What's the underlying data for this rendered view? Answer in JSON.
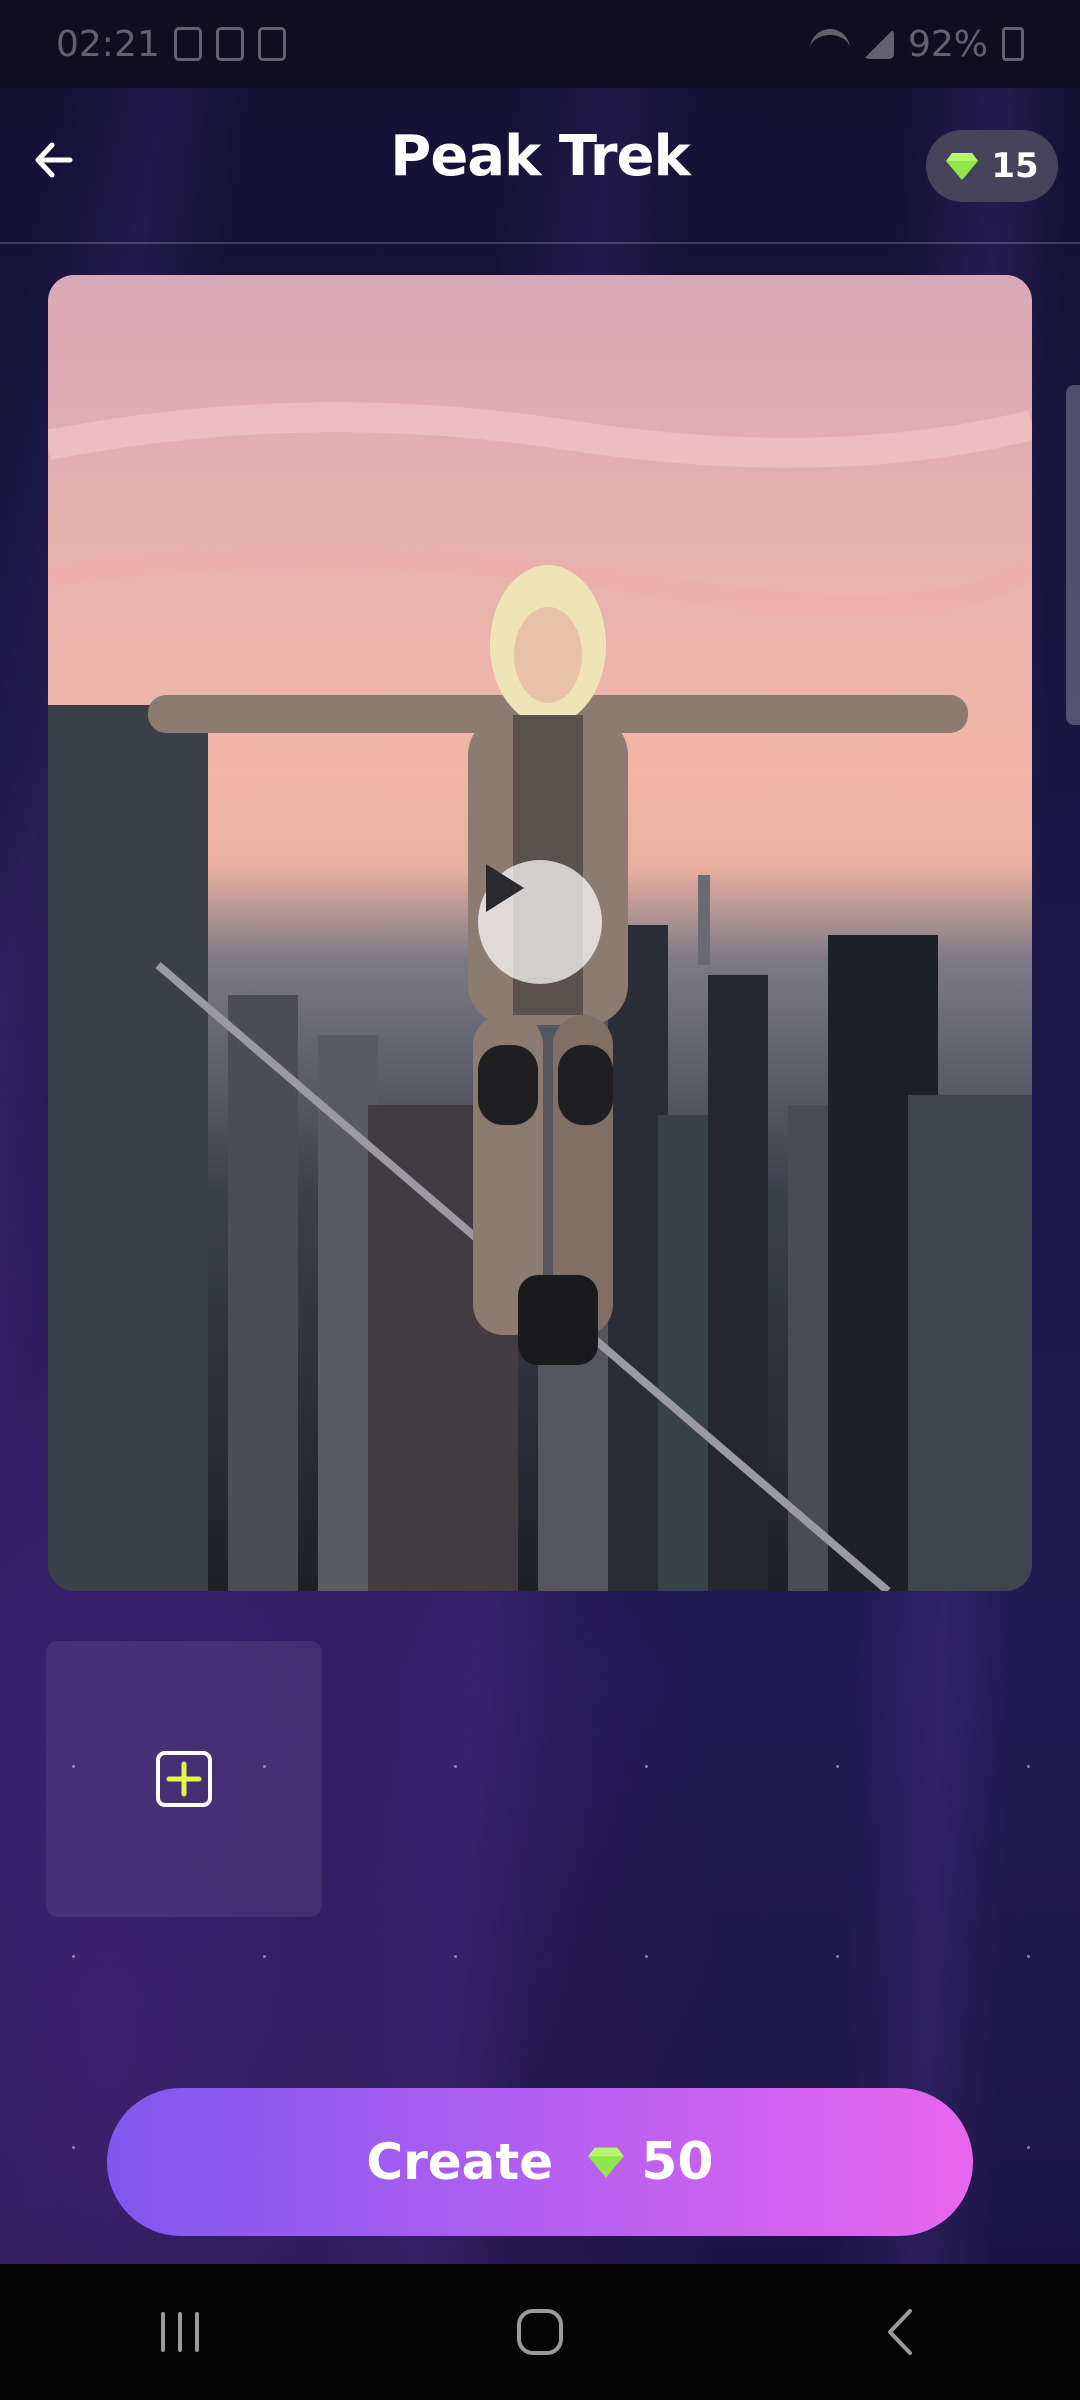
{
  "status_bar": {
    "time": "02:21",
    "battery": "92%"
  },
  "header": {
    "title": "Peak Trek",
    "gem_count": "15"
  },
  "video": {
    "state": "paused"
  },
  "add_tile": {
    "icon": "plus-square-icon",
    "accent": "#e8f542"
  },
  "create_button": {
    "label": "Create",
    "cost": "50",
    "gradient": [
      "#8058ef",
      "#e866ee"
    ]
  },
  "gem_color": "#8ee84a",
  "nav": {
    "items": [
      "recent-apps-icon",
      "home-icon",
      "back-icon"
    ]
  }
}
